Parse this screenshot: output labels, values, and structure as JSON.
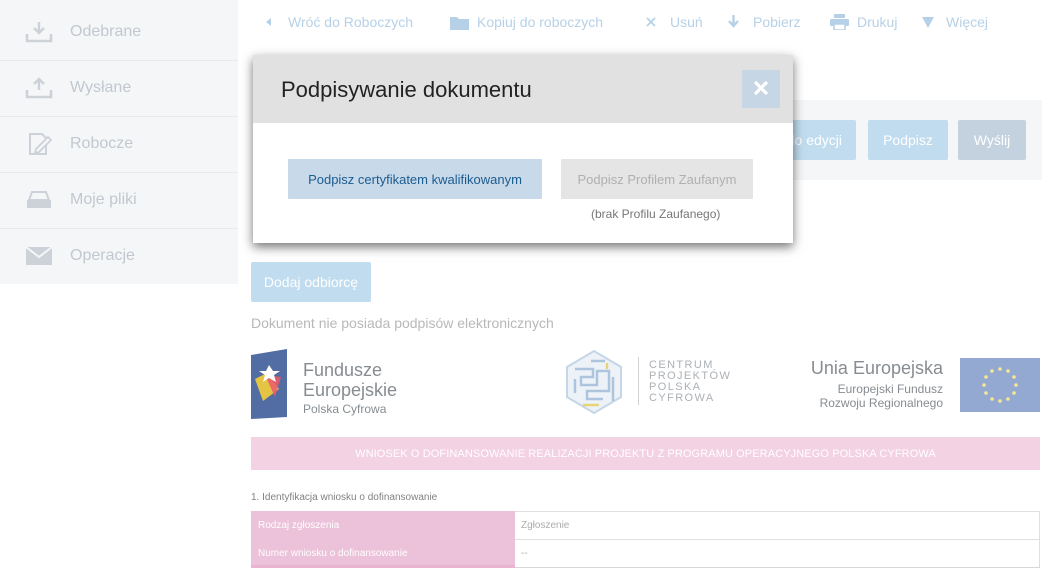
{
  "sidebar": {
    "items": [
      {
        "label": "Odebrane",
        "icon": "inbox-download-icon"
      },
      {
        "label": "Wysłane",
        "icon": "upload-icon"
      },
      {
        "label": "Robocze",
        "icon": "edit-document-icon"
      },
      {
        "label": "Moje pliki",
        "icon": "drawer-icon"
      },
      {
        "label": "Operacje",
        "icon": "envelope-icon"
      }
    ]
  },
  "toolbar": {
    "back": "Wróć do Roboczych",
    "copy": "Kopiuj do roboczych",
    "delete": "Usuń",
    "download": "Pobierz",
    "print": "Drukuj",
    "more": "Więcej"
  },
  "actions": {
    "edit_fragment": "do edycji",
    "sign": "Podpisz",
    "send": "Wyślij"
  },
  "content": {
    "add_recipient": "Dodaj odbiorcę",
    "no_signatures": "Dokument nie posiada podpisów elektronicznych",
    "banner": "WNIOSEK O DOFINANSOWANIE REALIZACJI PROJEKTU Z PROGRAMU OPERACYJNEGO POLSKA CYFROWA",
    "section_title": "1. Identyfikacja wniosku o dofinansowanie",
    "rows": [
      {
        "label": "Rodzaj zgłoszenia",
        "value": "Zgłoszenie"
      },
      {
        "label": "Numer wniosku o dofinansowanie",
        "value": "--"
      }
    ]
  },
  "logos": {
    "fe_line1": "Fundusze",
    "fe_line2": "Europejskie",
    "fe_line3": "Polska Cyfrowa",
    "cppc_line1": "CENTRUM",
    "cppc_line2": "PROJEKTÓW",
    "cppc_line3": "POLSKA",
    "cppc_line4": "CYFROWA",
    "ue_line1": "Unia Europejska",
    "ue_line2": "Europejski Fundusz",
    "ue_line3": "Rozwoju Regionalnego"
  },
  "modal": {
    "title": "Podpisywanie dokumentu",
    "cert_button": "Podpisz certyfikatem kwalifikowanym",
    "profile_button": "Podpisz Profilem Zaufanym",
    "profile_note": "(brak Profilu Zaufanego)"
  },
  "colors": {
    "sidebar_bg": "#f3f4f6",
    "toolbar_text": "#a7c7e2",
    "button_light_blue": "#b2d5eb",
    "send_button": "#b8c8d8",
    "banner_pink": "#f1c8dd",
    "table_label_pink": "#e8b4d2",
    "modal_header": "#e1e1e1",
    "close_button": "#c7d6e5",
    "cert_button": "#c8d9ea"
  }
}
